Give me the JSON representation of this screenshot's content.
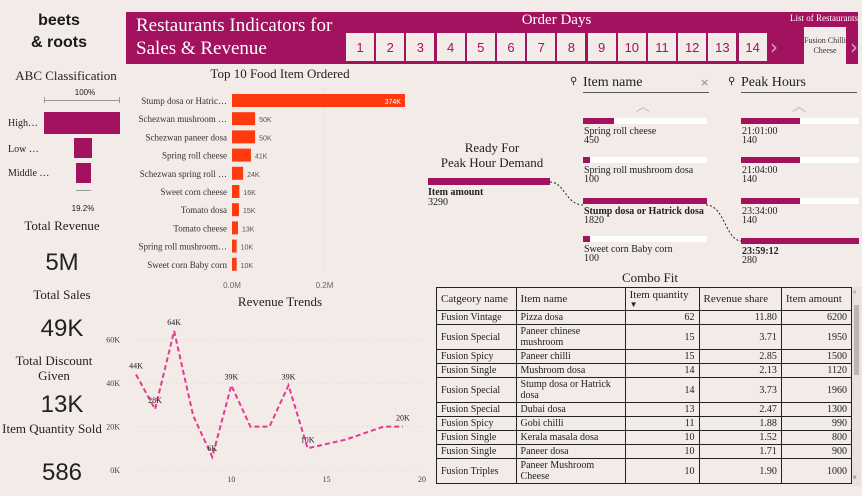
{
  "brand": {
    "line1": "beets",
    "line2": "& roots"
  },
  "header": {
    "title_line1": "Restaurants Indicators for",
    "title_line2": "Sales & Revenue",
    "order_days_label": "Order Days",
    "days": [
      "1",
      "2",
      "3",
      "4",
      "5",
      "6",
      "7",
      "8",
      "9",
      "10",
      "11",
      "12",
      "13",
      "14"
    ],
    "restaurants_label": "List of Restaurants",
    "restaurant_selected": "Fusion Chilli Cheese"
  },
  "abc": {
    "title": "ABC Classification",
    "top_pct": "100%",
    "bottom_pct": "19.2%",
    "levels": [
      "High…",
      "Low …",
      "Middle …"
    ]
  },
  "kpis": [
    {
      "label": "Total Revenue",
      "value": "5M"
    },
    {
      "label": "Total Sales",
      "value": "49K"
    },
    {
      "label": "Total Discount Given",
      "value": "13K"
    },
    {
      "label": "Item Quantity Sold",
      "value": "586"
    }
  ],
  "chart_data": [
    {
      "type": "bar",
      "orientation": "horizontal",
      "title": "Top 10 Food Item Ordered",
      "categories": [
        "Stump dosa or Hatric…",
        "Schezwan mushroom …",
        "Schezwan paneer dosa",
        "Spring roll cheese",
        "Schezwan spring roll …",
        "Sweet corn cheese",
        "Tomato dosa",
        "Tomato cheese",
        "Spring roll mushroom…",
        "Sweet corn Baby corn"
      ],
      "values": [
        374000,
        50000,
        50000,
        41000,
        24000,
        16000,
        15000,
        13000,
        10000,
        10000
      ],
      "data_labels": [
        "374K",
        "50K",
        "50K",
        "41K",
        "24K",
        "16K",
        "15K",
        "13K",
        "10K",
        "10K"
      ],
      "xticks": [
        "0.0M",
        "0.2M"
      ],
      "xlim": [
        0,
        400000
      ],
      "color": "#fe3a0e"
    },
    {
      "type": "line",
      "title": "Revenue Trends",
      "x": [
        5,
        6,
        7,
        8,
        9,
        10,
        11,
        12,
        13,
        14,
        15,
        16,
        17,
        18,
        19
      ],
      "y": [
        44000,
        28000,
        64000,
        25000,
        6000,
        39000,
        20000,
        20000,
        39000,
        10000,
        12000,
        14000,
        17000,
        20000,
        20000
      ],
      "point_labels": [
        {
          "x": 5,
          "text": "44K"
        },
        {
          "x": 6,
          "text": "28K"
        },
        {
          "x": 7,
          "text": "64K"
        },
        {
          "x": 9,
          "text": "6K"
        },
        {
          "x": 10,
          "text": "39K"
        },
        {
          "x": 13,
          "text": "39K"
        },
        {
          "x": 14,
          "text": "10K"
        },
        {
          "x": 19,
          "text": "20K"
        }
      ],
      "xticks": [
        "10",
        "15",
        "20"
      ],
      "yticks": [
        "0K",
        "20K",
        "40K",
        "60K"
      ],
      "xlim": [
        5,
        20
      ],
      "ylim": [
        0,
        70000
      ],
      "color": "#e63a8e"
    }
  ],
  "decomposition": {
    "ready_title_line1": "Ready For",
    "ready_title_line2": "Peak Hour Demand",
    "root_label": "Item amount",
    "root_value": "3290",
    "item_col_title": "Item name",
    "peak_col_title": "Peak Hours",
    "items": [
      {
        "name": "Spring roll cheese",
        "value": "450",
        "fill": 0.25,
        "bold": false
      },
      {
        "name": "Spring roll mushroom dosa",
        "value": "100",
        "fill": 0.06,
        "bold": false
      },
      {
        "name": "Stump dosa or Hatrick dosa",
        "value": "1820",
        "fill": 1.0,
        "bold": true
      },
      {
        "name": "Sweet corn Baby corn",
        "value": "100",
        "fill": 0.06,
        "bold": false
      }
    ],
    "peaks": [
      {
        "time": "21:01:00",
        "value": "140",
        "fill": 0.5,
        "bold": false
      },
      {
        "time": "21:04:00",
        "value": "140",
        "fill": 0.5,
        "bold": false
      },
      {
        "time": "23:34:00",
        "value": "140",
        "fill": 0.5,
        "bold": false
      },
      {
        "time": "23:59:12",
        "value": "280",
        "fill": 1.0,
        "bold": true
      }
    ]
  },
  "combo": {
    "title": "Combo Fit",
    "columns": [
      "Catgeory name",
      "Item name",
      "Item quantity",
      "Revenue share",
      "Item amount"
    ],
    "rows": [
      [
        "Fusion Vintage",
        "Pizza dosa",
        "62",
        "11.80",
        "6200"
      ],
      [
        "Fusion Special",
        "Paneer chinese mushroom",
        "15",
        "3.71",
        "1950"
      ],
      [
        "Fusion Spicy",
        "Paneer chilli",
        "15",
        "2.85",
        "1500"
      ],
      [
        "Fusion Single",
        "Mushroom dosa",
        "14",
        "2.13",
        "1120"
      ],
      [
        "Fusion Special",
        "Stump dosa or Hatrick dosa",
        "14",
        "3.73",
        "1960"
      ],
      [
        "Fusion Special",
        "Dubai dosa",
        "13",
        "2.47",
        "1300"
      ],
      [
        "Fusion Spicy",
        "Gobi chilli",
        "11",
        "1.88",
        "990"
      ],
      [
        "Fusion Single",
        "Kerala masala dosa",
        "10",
        "1.52",
        "800"
      ],
      [
        "Fusion Single",
        "Paneer dosa",
        "10",
        "1.71",
        "900"
      ],
      [
        "Fusion Triples",
        "Paneer Mushroom Cheese",
        "10",
        "1.90",
        "1000"
      ]
    ]
  },
  "colors": {
    "brand": "#a3125f",
    "bar": "#fe3a0e",
    "line": "#e63a8e",
    "background": "#f2ebe7"
  }
}
